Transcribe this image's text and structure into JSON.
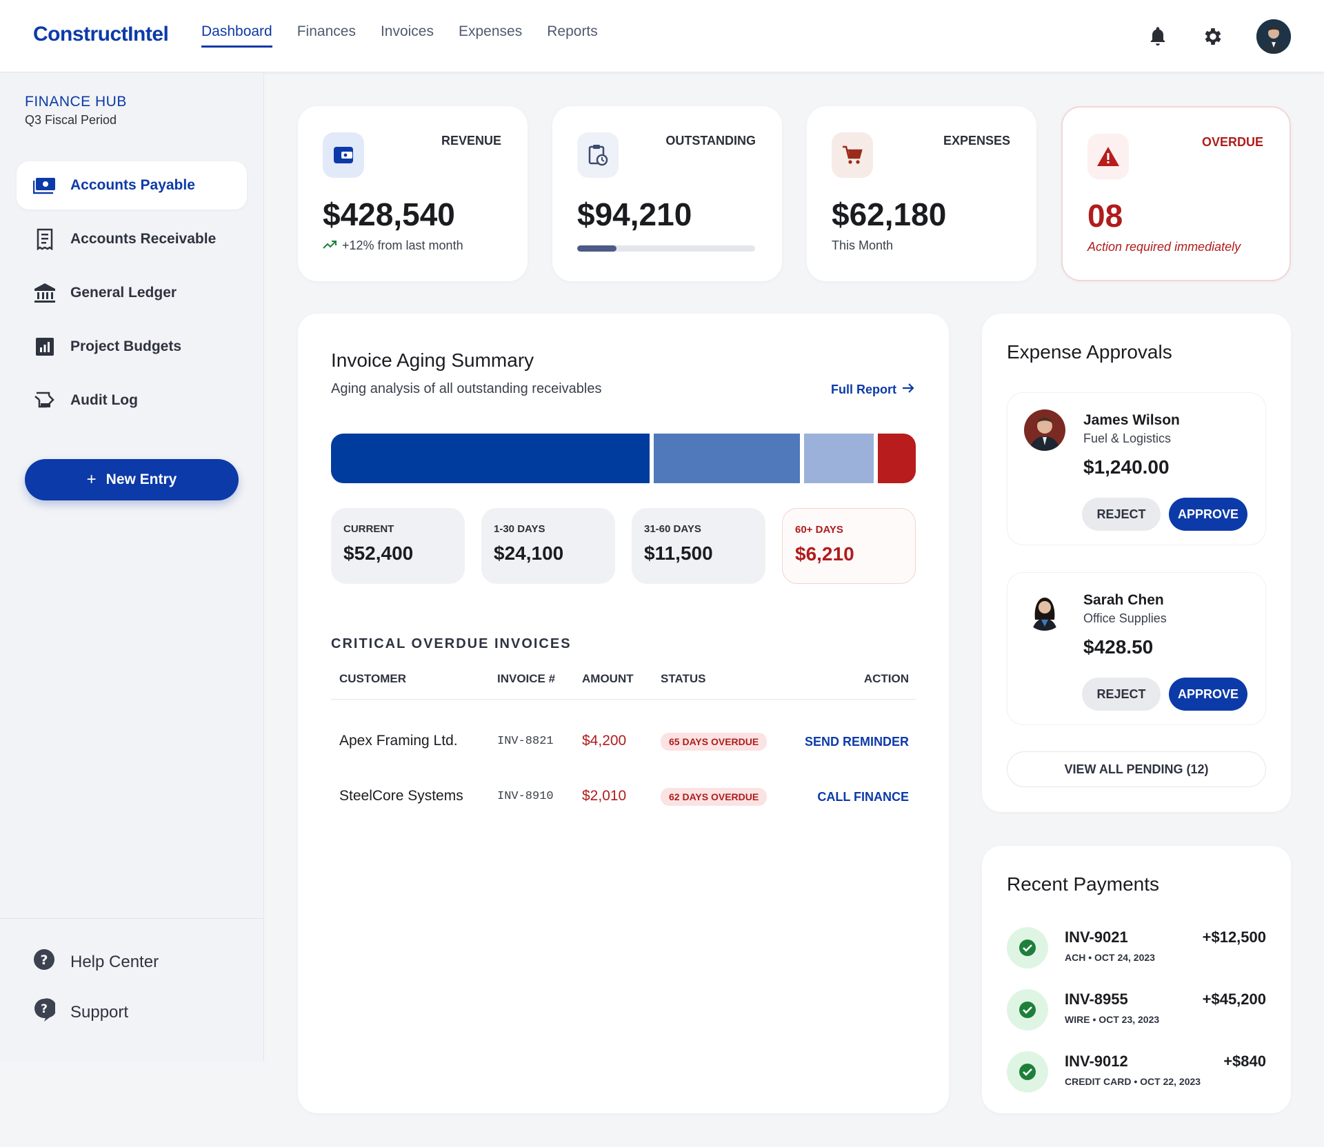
{
  "app": {
    "logo": "ConstructIntel"
  },
  "nav": {
    "links": [
      {
        "label": "Dashboard"
      },
      {
        "label": "Finances"
      },
      {
        "label": "Invoices"
      },
      {
        "label": "Expenses"
      },
      {
        "label": "Reports"
      }
    ],
    "icons": [
      "bell-icon",
      "gear-icon",
      "user-avatar"
    ]
  },
  "sidebar": {
    "hub_title": "FINANCE HUB",
    "hub_subtitle": "Q3 Fiscal Period",
    "items": [
      {
        "label": "Accounts Payable",
        "icon": "payments-icon",
        "active": true
      },
      {
        "label": "Accounts Receivable",
        "icon": "receipt-icon",
        "active": false
      },
      {
        "label": "General Ledger",
        "icon": "bank-icon",
        "active": false
      },
      {
        "label": "Project Budgets",
        "icon": "analytics-icon",
        "active": false
      },
      {
        "label": "Audit Log",
        "icon": "history-edu-icon",
        "active": false
      }
    ],
    "new_entry": "New Entry",
    "footer": [
      {
        "label": "Help Center",
        "icon": "help-icon"
      },
      {
        "label": "Support",
        "icon": "support-icon"
      }
    ]
  },
  "kpis": {
    "revenue": {
      "label": "REVENUE",
      "value": "$428,540",
      "sub": "+12% from last month",
      "icon": "wallet-icon"
    },
    "outstanding": {
      "label": "OUTSTANDING",
      "value": "$94,210",
      "progress": 0.22,
      "icon": "pending-actions-icon"
    },
    "expenses": {
      "label": "EXPENSES",
      "value": "$62,180",
      "sub": "This Month",
      "icon": "cart-icon"
    },
    "overdue": {
      "label": "OVERDUE",
      "value": "08",
      "sub": "Action required immediately",
      "icon": "warning-icon"
    }
  },
  "aging": {
    "title": "Invoice Aging Summary",
    "subtitle": "Aging analysis of all outstanding receivables",
    "full_report": "Full Report",
    "buckets": [
      {
        "label": "CURRENT",
        "value": "$52,400",
        "amount": 52400,
        "color": "#003c9e"
      },
      {
        "label": "1-30 DAYS",
        "value": "$24,100",
        "amount": 24100,
        "color": "#4f79bb"
      },
      {
        "label": "31-60 DAYS",
        "value": "$11,500",
        "amount": 11500,
        "color": "#9cb1d9"
      },
      {
        "label": "60+ DAYS",
        "value": "$6,210",
        "amount": 6210,
        "color": "#b81c1c"
      }
    ],
    "critical_title": "CRITICAL OVERDUE INVOICES",
    "columns": {
      "customer": "CUSTOMER",
      "invoice": "INVOICE #",
      "amount": "AMOUNT",
      "status": "STATUS",
      "action": "ACTION"
    },
    "rows": [
      {
        "customer": "Apex Framing Ltd.",
        "invoice": "INV-8821",
        "amount": "$4,200",
        "status": "65 DAYS OVERDUE",
        "action": "SEND REMINDER"
      },
      {
        "customer": "SteelCore Systems",
        "invoice": "INV-8910",
        "amount": "$2,010",
        "status": "62 DAYS OVERDUE",
        "action": "CALL FINANCE"
      }
    ]
  },
  "approvals": {
    "title": "Expense Approvals",
    "items": [
      {
        "name": "James Wilson",
        "category": "Fuel & Logistics",
        "amount": "$1,240.00",
        "reject": "REJECT",
        "approve": "APPROVE"
      },
      {
        "name": "Sarah Chen",
        "category": "Office Supplies",
        "amount": "$428.50",
        "reject": "REJECT",
        "approve": "APPROVE"
      }
    ],
    "view_all": "VIEW ALL PENDING (12)"
  },
  "payments": {
    "title": "Recent Payments",
    "items": [
      {
        "invoice": "INV-9021",
        "meta": "ACH • OCT 24, 2023",
        "amount": "+$12,500"
      },
      {
        "invoice": "INV-8955",
        "meta": "WIRE • OCT 23, 2023",
        "amount": "+$45,200"
      },
      {
        "invoice": "INV-9012",
        "meta": "CREDIT CARD • OCT 22, 2023",
        "amount": "+$840"
      }
    ]
  },
  "colors": {
    "primary": "#0c3aa8",
    "danger": "#b01c1c",
    "success": "#1e7f3a"
  }
}
